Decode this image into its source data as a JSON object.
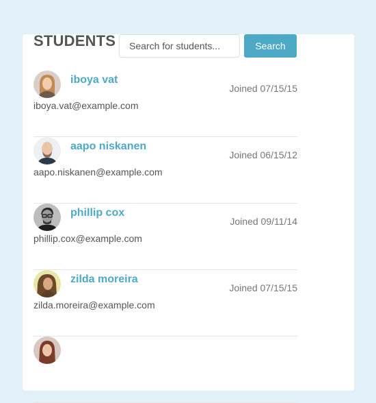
{
  "header": {
    "title": "STUDENTS",
    "search_placeholder": "Search for students...",
    "search_button": "Search"
  },
  "colors": {
    "background": "#e2f0f7",
    "accent": "#4ea9c6",
    "title": "#555555"
  },
  "students": [
    {
      "name": "iboya vat",
      "email": "iboya.vat@example.com",
      "joined": "Joined 07/15/15",
      "avatar_icon": "woman-portrait"
    },
    {
      "name": "aapo niskanen",
      "email": "aapo.niskanen@example.com",
      "joined": "Joined 06/15/12",
      "avatar_icon": "bald-man-portrait"
    },
    {
      "name": "phillip cox",
      "email": "phillip.cox@example.com",
      "joined": "Joined 09/11/14",
      "avatar_icon": "man-glasses-portrait"
    },
    {
      "name": "zilda moreira",
      "email": "zilda.moreira@example.com",
      "joined": "Joined 07/15/15",
      "avatar_icon": "woman-portrait"
    },
    {
      "name": "",
      "email": "",
      "joined": "",
      "avatar_icon": "woman-portrait"
    }
  ]
}
